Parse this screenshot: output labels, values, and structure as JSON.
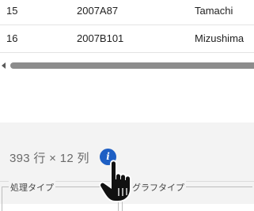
{
  "table": {
    "rows": [
      [
        "15",
        "2007A87",
        "Tamachi"
      ],
      [
        "16",
        "2007B101",
        "Mizushima"
      ]
    ]
  },
  "status": {
    "row_count": "393 行 × 12 列"
  },
  "options": {
    "process_type_label": "処理タイプ",
    "graph_type_label": "グラフタイプ"
  },
  "icons": {
    "info": "info-icon",
    "cursor": "hand-pointer-cursor",
    "scroll_left": "triangle-left-icon"
  },
  "colors": {
    "accent": "#1e5fc4",
    "panel_background": "#f3f3f3",
    "scrollbar_thumb": "#8c8c8c"
  }
}
